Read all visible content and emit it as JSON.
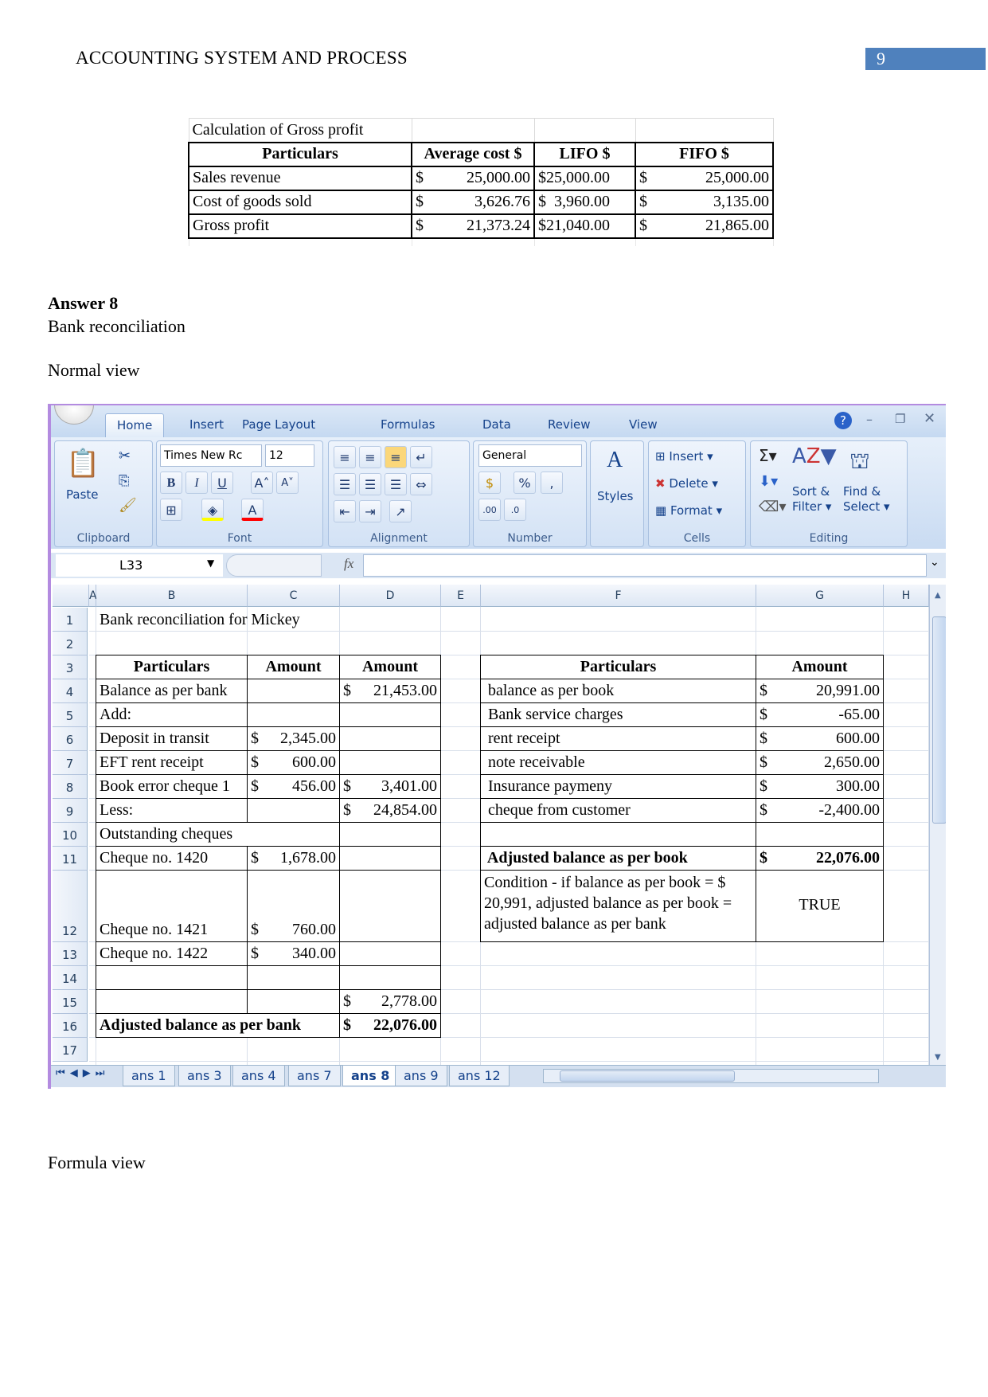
{
  "header": {
    "title": "ACCOUNTING SYSTEM AND PROCESS",
    "page_number": "9",
    "accent": "#4f81bd"
  },
  "gross_profit": {
    "title": "Calculation of Gross profit",
    "columns": [
      "Particulars",
      "Average cost $",
      "LIFO $",
      "FIFO $"
    ],
    "rows": [
      {
        "label": "Sales revenue",
        "avg": "25,000.00",
        "lifo": "$25,000.00",
        "fifo": "25,000.00"
      },
      {
        "label": "Cost of goods sold",
        "avg": "3,626.76",
        "lifo": "$  3,960.00",
        "fifo": "3,135.00"
      },
      {
        "label": "Gross profit",
        "avg": "21,373.24",
        "lifo": "$21,040.00",
        "fifo": "21,865.00"
      }
    ],
    "currency": "$"
  },
  "answer_heading": "Answer 8",
  "subtitle": "Bank reconciliation",
  "normal_view_label": "Normal view",
  "formula_view_label": "Formula view",
  "excel": {
    "ribbon_tabs": [
      "Home",
      "Insert",
      "Page Layout",
      "Formulas",
      "Data",
      "Review",
      "View"
    ],
    "active_tab": "Home",
    "groups": {
      "clipboard": "Clipboard",
      "font": "Font",
      "alignment": "Alignment",
      "number": "Number",
      "cells": "Cells",
      "editing": "Editing"
    },
    "paste": "Paste",
    "font_name": "Times New Rc",
    "font_size": "12",
    "number_format": "General",
    "styles": "Styles",
    "cells_buttons": [
      "Insert",
      "Delete",
      "Format"
    ],
    "sort_filter": [
      "Sort &",
      "Filter"
    ],
    "find_select": [
      "Find &",
      "Select"
    ],
    "name_box": "L33",
    "fx": "fx",
    "columns": [
      "A",
      "B",
      "C",
      "D",
      "E",
      "F",
      "G",
      "H"
    ],
    "sheet_tabs": [
      "ans 1",
      "ans 3",
      "ans 4",
      "ans 7",
      "ans 8",
      "ans 9",
      "ans 12"
    ],
    "active_sheet": "ans 8"
  },
  "sheet": {
    "rows": [
      {
        "r": 1,
        "cells": [
          {
            "c": "B",
            "t": "Bank reconciliation for Mickey"
          }
        ]
      },
      {
        "r": 2,
        "cells": []
      },
      {
        "r": 3,
        "cells": [
          {
            "c": "B",
            "t": "Particulars",
            "b": true,
            "center": true
          },
          {
            "c": "C",
            "t": "Amount",
            "b": true,
            "center": true
          },
          {
            "c": "D",
            "t": "Amount",
            "b": true,
            "center": true
          },
          {
            "c": "F",
            "t": "Particulars",
            "b": true,
            "center": true
          },
          {
            "c": "G",
            "t": "Amount",
            "b": true,
            "center": true
          }
        ]
      },
      {
        "r": 4,
        "cells": [
          {
            "c": "B",
            "t": "Balance as per bank"
          },
          {
            "c": "D",
            "cur": "$",
            "t": "21,453.00"
          },
          {
            "c": "F",
            "t": " balance as per book"
          },
          {
            "c": "G",
            "cur": "$",
            "t": "20,991.00"
          }
        ]
      },
      {
        "r": 5,
        "cells": [
          {
            "c": "B",
            "t": "Add:"
          },
          {
            "c": "F",
            "t": " Bank service charges"
          },
          {
            "c": "G",
            "cur": "$",
            "t": "-65.00"
          }
        ]
      },
      {
        "r": 6,
        "cells": [
          {
            "c": "B",
            "t": "Deposit in transit"
          },
          {
            "c": "C",
            "cur": "$",
            "t": "2,345.00"
          },
          {
            "c": "F",
            "t": " rent receipt"
          },
          {
            "c": "G",
            "cur": "$",
            "t": "600.00"
          }
        ]
      },
      {
        "r": 7,
        "cells": [
          {
            "c": "B",
            "t": "EFT rent receipt"
          },
          {
            "c": "C",
            "cur": "$",
            "t": "600.00"
          },
          {
            "c": "F",
            "t": " note receivable"
          },
          {
            "c": "G",
            "cur": "$",
            "t": "2,650.00"
          }
        ]
      },
      {
        "r": 8,
        "cells": [
          {
            "c": "B",
            "t": "Book error cheque 1"
          },
          {
            "c": "C",
            "cur": "$",
            "t": "456.00"
          },
          {
            "c": "D",
            "cur": "$",
            "t": "3,401.00"
          },
          {
            "c": "F",
            "t": " Insurance paymeny"
          },
          {
            "c": "G",
            "cur": "$",
            "t": "300.00"
          }
        ]
      },
      {
        "r": 9,
        "cells": [
          {
            "c": "B",
            "t": "Less:"
          },
          {
            "c": "D",
            "cur": "$",
            "t": "24,854.00"
          },
          {
            "c": "F",
            "t": " cheque from customer"
          },
          {
            "c": "G",
            "cur": "$",
            "t": "-2,400.00"
          }
        ]
      },
      {
        "r": 10,
        "cells": [
          {
            "c": "B",
            "t": "Outstanding cheques"
          }
        ]
      },
      {
        "r": 11,
        "cells": [
          {
            "c": "B",
            "t": "Cheque no. 1420"
          },
          {
            "c": "C",
            "cur": "$",
            "t": "1,678.00"
          },
          {
            "c": "F",
            "t": " Adjusted balance as per book",
            "b": true
          },
          {
            "c": "G",
            "cur": "$",
            "t": "22,076.00",
            "b": true
          }
        ]
      },
      {
        "r": 12,
        "cells": [
          {
            "c": "B",
            "t": "Cheque no. 1421"
          },
          {
            "c": "C",
            "cur": "$",
            "t": "760.00"
          },
          {
            "c": "F",
            "t": "Condition - if balance as per book = $ 20,991, adjusted balance as per book = adjusted balance as per bank",
            "wrap": true
          },
          {
            "c": "G",
            "t": "TRUE",
            "center": true,
            "mid": true
          }
        ]
      },
      {
        "r": 13,
        "cells": [
          {
            "c": "B",
            "t": "Cheque no. 1422"
          },
          {
            "c": "C",
            "cur": "$",
            "t": "340.00"
          }
        ]
      },
      {
        "r": 14,
        "cells": []
      },
      {
        "r": 15,
        "cells": [
          {
            "c": "D",
            "cur": "$",
            "t": "2,778.00"
          }
        ]
      },
      {
        "r": 16,
        "cells": [
          {
            "c": "B",
            "t": "Adjusted balance as per bank",
            "b": true
          },
          {
            "c": "D",
            "cur": "$",
            "t": "22,076.00",
            "b": true
          }
        ]
      },
      {
        "r": 17,
        "cells": []
      }
    ]
  }
}
